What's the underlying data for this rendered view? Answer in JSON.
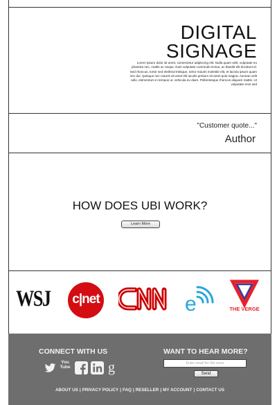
{
  "hero": {
    "title_line1": "DIGITAL",
    "title_line2": "SIGNAGE",
    "body": "Lorem ipsum dolor sit amet, consectetur adipiscing elit. Nulla quam velit, vulputate eu pharetra nec, mattis ac neque. Duis vulputate commodo lectus, ac blandit elit tincidunt id. Sed rhoncus, tortor sed eleifend tristique, tortor mauris molestie elit, et lacinia ipsum quam nec dui. Quisque nec mauris sit amet elit iaculis pretium sit amet quis magna. Aenean velit odio, elementum in tempus ut, vehicula eu diam. Pellentesque rhoncus aliquam mattis. Ut vulputate eros sed"
  },
  "quote": {
    "text": "\"Customer quote...\"",
    "author": "Author"
  },
  "how": {
    "title": "HOW DOES UBI WORK?",
    "button_label": "Learn More"
  },
  "logos": {
    "wsj": "WSJ",
    "cnet": "c|net",
    "verge": "THE VERGE",
    "icons": [
      "wsj-logo",
      "cnet-logo",
      "cnn-logo",
      "e-wifi-logo",
      "the-verge-logo"
    ],
    "colors": {
      "cnet": "#d40d12",
      "cnn": "#cc0000",
      "e_icon": "#27a6dc",
      "verge_red": "#e8212a",
      "verge_blue": "#3b3b9c"
    }
  },
  "footer": {
    "connect_title": "CONNECT WITH US",
    "social_icons": [
      "twitter-icon",
      "youtube-icon",
      "facebook-icon",
      "linkedin-icon",
      "google-plus-icon"
    ],
    "youtube_text": "You Tube",
    "want_title": "WANT TO HEAR MORE?",
    "email_placeholder": "Enter email for Ubi news",
    "send_label": "Send",
    "links": [
      {
        "label": "ABOUT US"
      },
      {
        "label": "PRIVACY POLICY"
      },
      {
        "label": "FAQ"
      },
      {
        "label": "RESELLER"
      },
      {
        "label": "MY ACCOUNT"
      },
      {
        "label": "CONTACT US"
      }
    ],
    "separator": "|",
    "background": "#6e6e6e"
  }
}
